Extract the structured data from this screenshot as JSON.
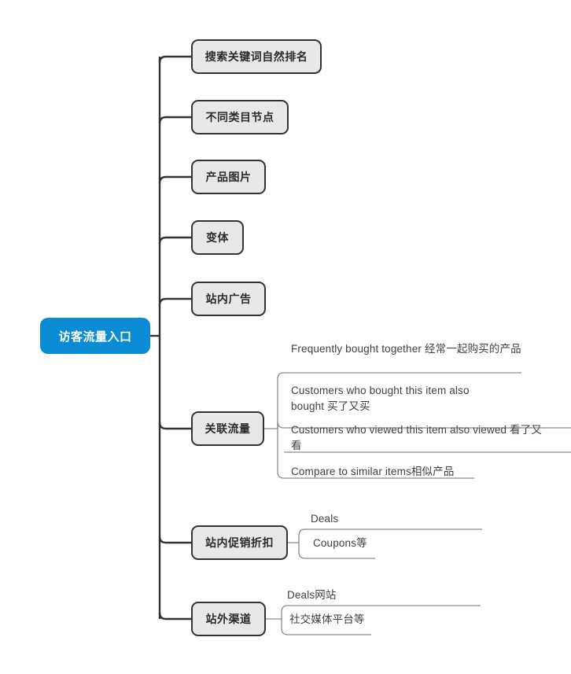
{
  "diagram": {
    "type": "mind-map",
    "title_node": "访客流量入口",
    "colors": {
      "root_fill": "#0b8bd4",
      "root_text": "#ffffff",
      "node_fill": "#e8e8e8",
      "node_border": "#333333",
      "node_text": "#2b2b2b",
      "connector": "#333333",
      "sub_connector": "#888888",
      "leaf_text": "#404040",
      "background": "#ffffff"
    },
    "root": {
      "label": "访客流量入口"
    },
    "branches": [
      {
        "label": "搜索关键词自然排名",
        "children": []
      },
      {
        "label": "不同类目节点",
        "children": []
      },
      {
        "label": "产品图片",
        "children": []
      },
      {
        "label": "变体",
        "children": []
      },
      {
        "label": "站内广告",
        "children": []
      },
      {
        "label": "关联流量",
        "children": [
          "Frequently bought together 经常一起购买的产品",
          "Customers who bought this item also bought 买了又买",
          "Customers who viewed this item also viewed 看了又看",
          "Compare to similar items相似产品"
        ]
      },
      {
        "label": "站内促销折扣",
        "children": [
          "Deals",
          "Coupons等"
        ]
      },
      {
        "label": "站外渠道",
        "children": [
          "Deals网站",
          "社交媒体平台等"
        ]
      }
    ]
  }
}
